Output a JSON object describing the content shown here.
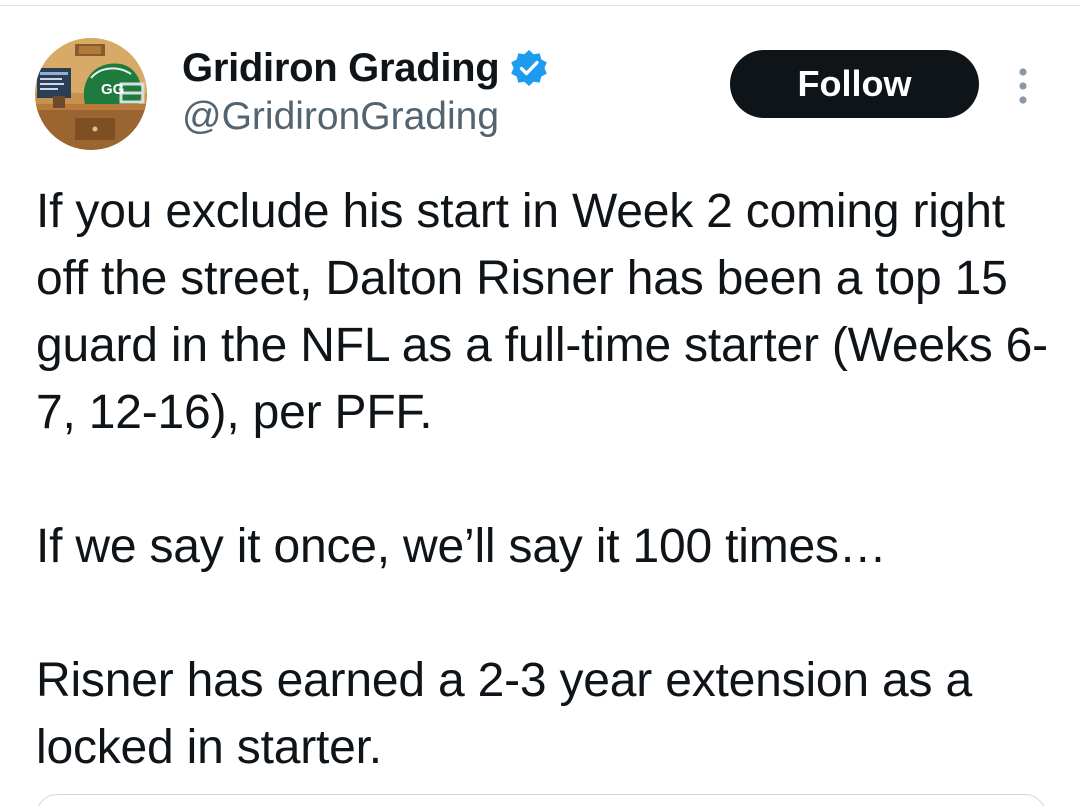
{
  "author": {
    "display_name": "Gridiron Grading",
    "handle": "@GridironGrading",
    "verified": true,
    "avatar_icon": "gridiron-grading-helmet-avatar",
    "avatar_letters": "GG"
  },
  "actions": {
    "follow_label": "Follow",
    "more_icon": "more-vertical-icon"
  },
  "tweet": {
    "paragraphs": [
      "If you exclude his start in Week 2 coming right off the street, Dalton Risner has been a top 15 guard in the NFL as a full-time starter (Weeks 6-7, 12-16), per PFF.",
      "If we say it once, we’ll say it 100 times…",
      "Risner has earned a 2-3 year extension as a locked in starter."
    ]
  },
  "colors": {
    "text_primary": "#0f1419",
    "text_secondary": "#536471",
    "verified_blue": "#1d9bf0",
    "follow_bg": "#0f1419",
    "follow_text": "#ffffff"
  }
}
